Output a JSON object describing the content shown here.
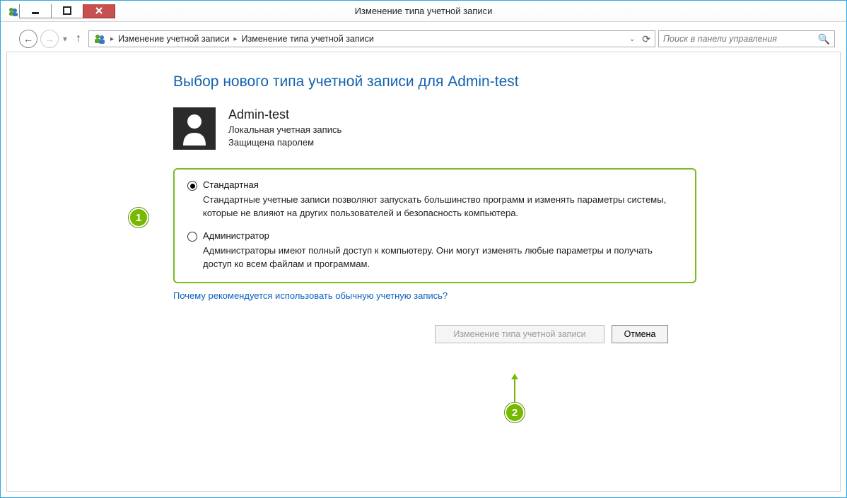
{
  "window": {
    "title": "Изменение типа учетной записи"
  },
  "breadcrumb": {
    "item1": "Изменение учетной записи",
    "item2": "Изменение типа учетной записи"
  },
  "search": {
    "placeholder": "Поиск в панели управления"
  },
  "heading": "Выбор нового типа учетной записи для Admin-test",
  "user": {
    "name": "Admin-test",
    "line1": "Локальная учетная запись",
    "line2": "Защищена паролем"
  },
  "options": {
    "standard": {
      "label": "Стандартная",
      "desc": "Стандартные учетные записи позволяют запускать большинство программ и изменять параметры системы, которые не влияют на других пользователей и безопасность компьютера."
    },
    "admin": {
      "label": "Администратор",
      "desc": "Администраторы имеют полный доступ к компьютеру. Они могут изменять любые параметры и получать доступ ко всем файлам и программам."
    }
  },
  "help_link": "Почему рекомендуется использовать обычную учетную запись?",
  "buttons": {
    "change": "Изменение типа учетной записи",
    "cancel": "Отмена"
  },
  "callouts": {
    "one": "1",
    "two": "2"
  }
}
